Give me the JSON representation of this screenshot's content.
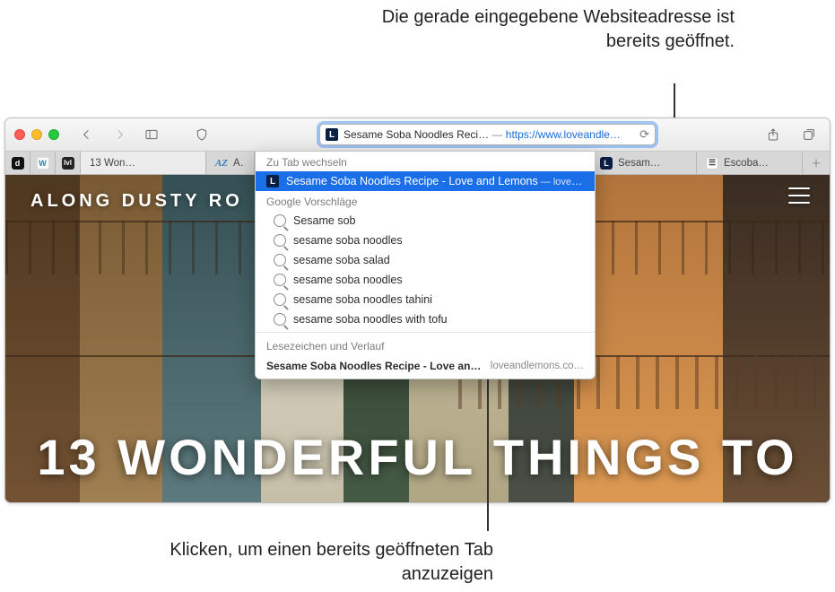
{
  "callouts": {
    "top": "Die gerade eingegebene Websiteadresse ist bereits geöffnet.",
    "bottom": "Klicken, um einen bereits geöffneten Tab anzuzeigen"
  },
  "address_bar": {
    "title_part": "Sesame Soba Noodles Reci…",
    "dash": " — ",
    "url_part": "https://www.loveandle…"
  },
  "tabs": [
    {
      "icon_class": "d",
      "label": "",
      "icon_text": "d"
    },
    {
      "icon_class": "w",
      "label": "",
      "icon_text": "W"
    },
    {
      "icon_class": "lvl",
      "label": "",
      "icon_text": "lvl"
    },
    {
      "icon_class": "",
      "label": "13 Won…",
      "icon_text": "",
      "active": true
    },
    {
      "icon_class": "az",
      "label": "A…",
      "icon_text": "AZ"
    },
    {
      "icon_class": "l",
      "label": "Sesam…",
      "icon_text": "L"
    },
    {
      "icon_class": "e",
      "label": "Escoba…",
      "icon_text": "☰"
    }
  ],
  "dropdown": {
    "switch_header": "Zu Tab wechseln",
    "switch_item_title": "Sesame Soba Noodles Recipe - Love and Lemons",
    "switch_item_sub": " — lovean…",
    "google_header": "Google Vorschläge",
    "suggestions": [
      "Sesame sob",
      "sesame soba noodles",
      "sesame soba salad",
      "sesame soba noodles",
      "sesame soba noodles tahini",
      "sesame soba noodles with tofu"
    ],
    "history_header": "Lesezeichen und Verlauf",
    "history_title": "Sesame Soba Noodles Recipe - Love an…",
    "history_domain": "loveandlemons.co…"
  },
  "page": {
    "site_name": "ALONG DUSTY RO",
    "hero": "13 WONDERFUL THINGS TO"
  }
}
